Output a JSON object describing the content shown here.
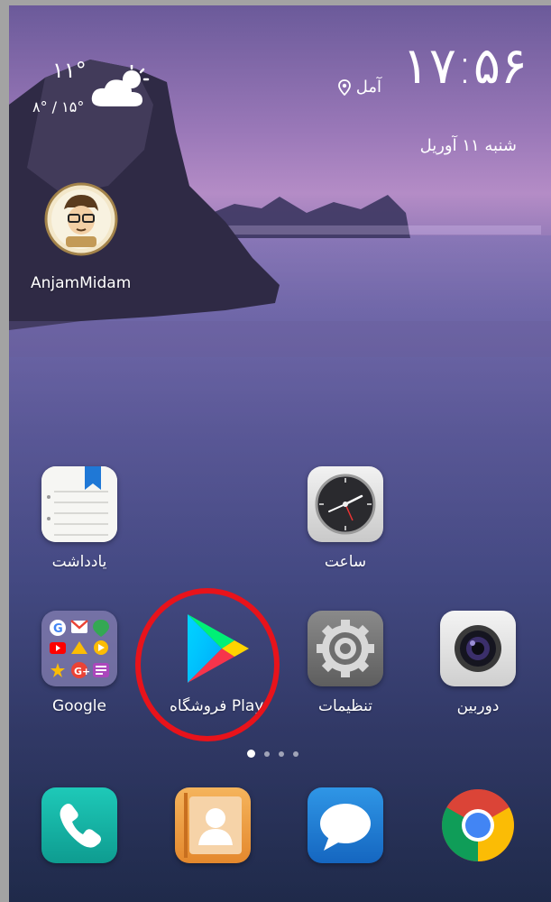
{
  "status": {
    "time": "۱۷:۵۶",
    "location": "آمل",
    "date": "شنبه ۱۱ آوریل"
  },
  "weather": {
    "temperature": "۱۱°",
    "range": "۸° / ۱۵°",
    "icon": "partly-cloudy-icon"
  },
  "shortcut": {
    "label": "AnjamMidam"
  },
  "apps_row1": [
    {
      "label": "یادداشت",
      "icon": "notes-icon"
    },
    {
      "label": "ساعت",
      "icon": "clock-icon"
    }
  ],
  "apps_row2": [
    {
      "label": "Google",
      "icon": "google-folder-icon"
    },
    {
      "label": "فروشگاه Play",
      "icon": "play-store-icon"
    },
    {
      "label": "تنظیمات",
      "icon": "settings-gear-icon"
    },
    {
      "label": "دوربین",
      "icon": "camera-icon"
    }
  ],
  "dock": [
    {
      "icon": "phone-icon"
    },
    {
      "icon": "contacts-icon"
    },
    {
      "icon": "messages-icon"
    },
    {
      "icon": "chrome-icon"
    }
  ],
  "page_indicator": {
    "pages": 4,
    "current": 1
  },
  "colors": {
    "highlight_circle": "#e8131b",
    "phone": "#12b5a6",
    "contacts": "#f0a24a",
    "messages": "#1f7fd3"
  }
}
